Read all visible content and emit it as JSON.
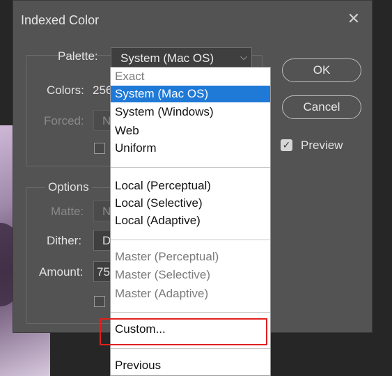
{
  "dialog": {
    "title": "Indexed Color",
    "close_glyph": "✕"
  },
  "palette_group": {
    "palette_label": "Palette:",
    "palette_value": "System (Mac OS)",
    "colors_label": "Colors:",
    "colors_value": "256",
    "forced_label": "Forced:",
    "forced_value": "None"
  },
  "options_group": {
    "heading": "Options",
    "matte_label": "Matte:",
    "matte_value": "None",
    "dither_label": "Dither:",
    "dither_value": "Diffusion",
    "amount_label": "Amount:",
    "amount_value": "75"
  },
  "buttons": {
    "ok": "OK",
    "cancel": "Cancel"
  },
  "preview": {
    "label": "Preview",
    "checked": true
  },
  "dropdown": {
    "items": [
      {
        "label": "Exact",
        "enabled": false,
        "selected": false
      },
      {
        "label": "System (Mac OS)",
        "enabled": true,
        "selected": true
      },
      {
        "label": "System (Windows)",
        "enabled": true,
        "selected": false
      },
      {
        "label": "Web",
        "enabled": true,
        "selected": false
      },
      {
        "label": "Uniform",
        "enabled": true,
        "selected": false
      },
      {
        "label": "Local (Perceptual)",
        "enabled": true,
        "selected": false
      },
      {
        "label": "Local (Selective)",
        "enabled": true,
        "selected": false
      },
      {
        "label": "Local (Adaptive)",
        "enabled": true,
        "selected": false
      },
      {
        "label": "Master (Perceptual)",
        "enabled": false,
        "selected": false
      },
      {
        "label": "Master (Selective)",
        "enabled": false,
        "selected": false
      },
      {
        "label": "Master (Adaptive)",
        "enabled": false,
        "selected": false
      },
      {
        "label": "Custom...",
        "enabled": true,
        "selected": false
      },
      {
        "label": "Previous",
        "enabled": true,
        "selected": false
      }
    ]
  },
  "colors": {
    "dialog_bg": "#535353",
    "selection": "#1f79d6",
    "annotation": "#e02020"
  }
}
